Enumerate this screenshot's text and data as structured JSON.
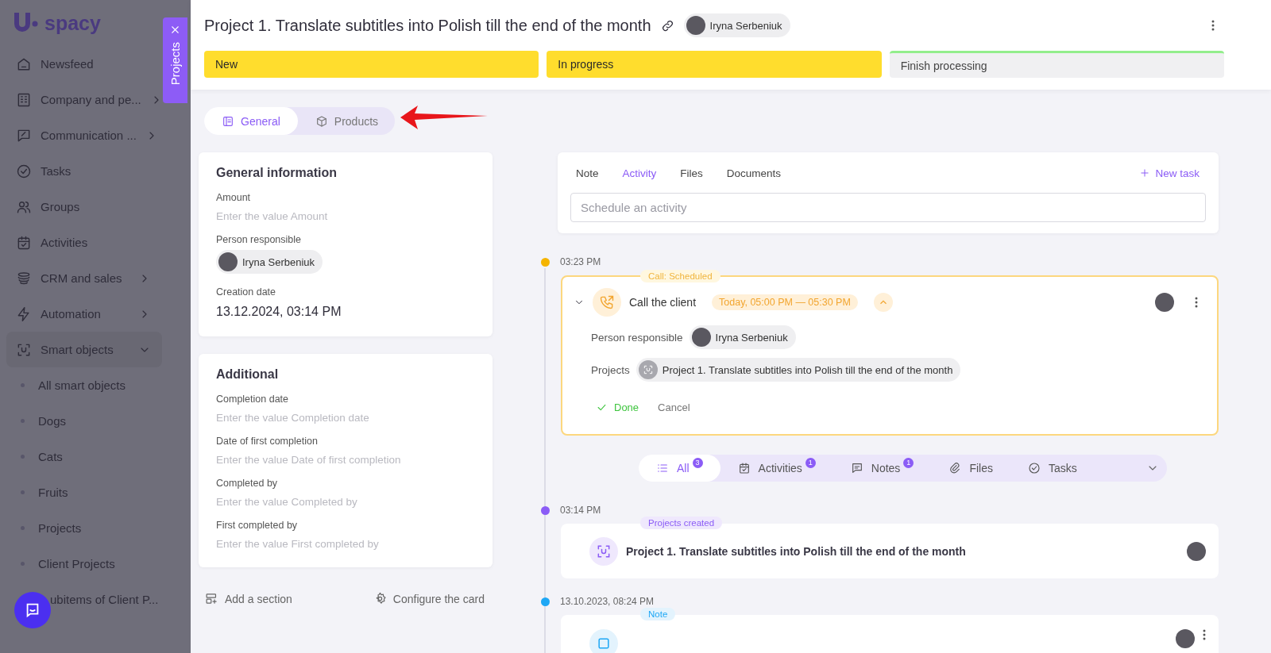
{
  "sidebar": {
    "logo": "spacy",
    "items": [
      {
        "label": "Newsfeed",
        "submenu": false,
        "selected": false
      },
      {
        "label": "Company and pe...",
        "submenu": true,
        "selected": false
      },
      {
        "label": "Communication ...",
        "submenu": true,
        "selected": false
      },
      {
        "label": "Tasks",
        "submenu": false,
        "selected": false
      },
      {
        "label": "Groups",
        "submenu": false,
        "selected": false
      },
      {
        "label": "Activities",
        "submenu": false,
        "selected": false
      },
      {
        "label": "CRM and sales",
        "submenu": true,
        "selected": false
      },
      {
        "label": "Automation",
        "submenu": true,
        "selected": false
      },
      {
        "label": "Smart objects",
        "submenu": true,
        "selected": true,
        "expanded": true,
        "children": [
          {
            "label": "All smart objects"
          },
          {
            "label": "Dogs"
          },
          {
            "label": "Cats"
          },
          {
            "label": "Fruits"
          },
          {
            "label": "Projects"
          },
          {
            "label": "Client Projects"
          },
          {
            "label": "ubitems of Client P..."
          }
        ]
      }
    ]
  },
  "side_tab": {
    "label": "Projects"
  },
  "header": {
    "title": "Project 1. Translate subtitles into Polish till the end of the month",
    "assignee": {
      "name": "Iryna Serbeniuk"
    },
    "stages": [
      {
        "label": "New",
        "kind": "step",
        "reached": true
      },
      {
        "label": "In progress",
        "kind": "step",
        "reached": true
      },
      {
        "label": "Finish processing",
        "kind": "final",
        "reached": false
      }
    ]
  },
  "view_tabs": [
    {
      "label": "General",
      "selected": true
    },
    {
      "label": "Products",
      "selected": false
    }
  ],
  "cards": [
    {
      "title": "General information",
      "fields": [
        {
          "label": "Amount",
          "kind": "empty",
          "placeholder": "Enter the value Amount"
        },
        {
          "label": "Person responsible",
          "kind": "person",
          "value": "Iryna Serbeniuk"
        },
        {
          "label": "Creation date",
          "kind": "text",
          "value": "13.12.2024, 03:14 PM"
        }
      ]
    },
    {
      "title": "Additional",
      "fields": [
        {
          "label": "Completion date",
          "kind": "empty",
          "placeholder": "Enter the value Completion date"
        },
        {
          "label": "Date of first completion",
          "kind": "empty",
          "placeholder": "Enter the value Date of first completion"
        },
        {
          "label": "Completed by",
          "kind": "empty",
          "placeholder": "Enter the value Completed by"
        },
        {
          "label": "First completed by",
          "kind": "empty",
          "placeholder": "Enter the value First completed by"
        }
      ]
    }
  ],
  "card_actions": [
    "Add a section",
    "Configure the card"
  ],
  "composer": {
    "tabs": [
      {
        "label": "Note",
        "selected": false
      },
      {
        "label": "Activity",
        "selected": true
      },
      {
        "label": "Files",
        "selected": false
      },
      {
        "label": "Documents",
        "selected": false
      }
    ],
    "new_task": "New task",
    "input": {
      "placeholder": "Schedule an activity"
    }
  },
  "timeline": [
    {
      "kind": "activity",
      "time": "03:23 PM",
      "color": "#f5b400",
      "badge": "Call: Scheduled",
      "title": "Call the client",
      "schedule": "Today, 05:00 PM — 05:30 PM",
      "expanded": true,
      "details": [
        {
          "label": "Person responsible",
          "kind": "person",
          "value": "Iryna Serbeniuk"
        },
        {
          "label": "Projects",
          "kind": "project",
          "value": "Project 1. Translate subtitles into Polish till the end of the month"
        }
      ],
      "done": "Done",
      "cancel": "Cancel"
    },
    {
      "kind": "filters",
      "tabs": [
        {
          "label": "All",
          "count": "3",
          "selected": true
        },
        {
          "label": "Activities",
          "count": "1",
          "selected": false
        },
        {
          "label": "Notes",
          "count": "1",
          "selected": false
        },
        {
          "label": "Files",
          "selected": false
        },
        {
          "label": "Tasks",
          "selected": false
        }
      ]
    },
    {
      "kind": "event",
      "time": "03:14 PM",
      "color": "#8b5cf6",
      "badge": "Projects created",
      "text": "Project 1. Translate subtitles into Polish till the end of the month"
    },
    {
      "kind": "note",
      "time": "13.10.2023, 08:24 PM",
      "color": "#1ea7f5",
      "badge": "Note"
    }
  ]
}
